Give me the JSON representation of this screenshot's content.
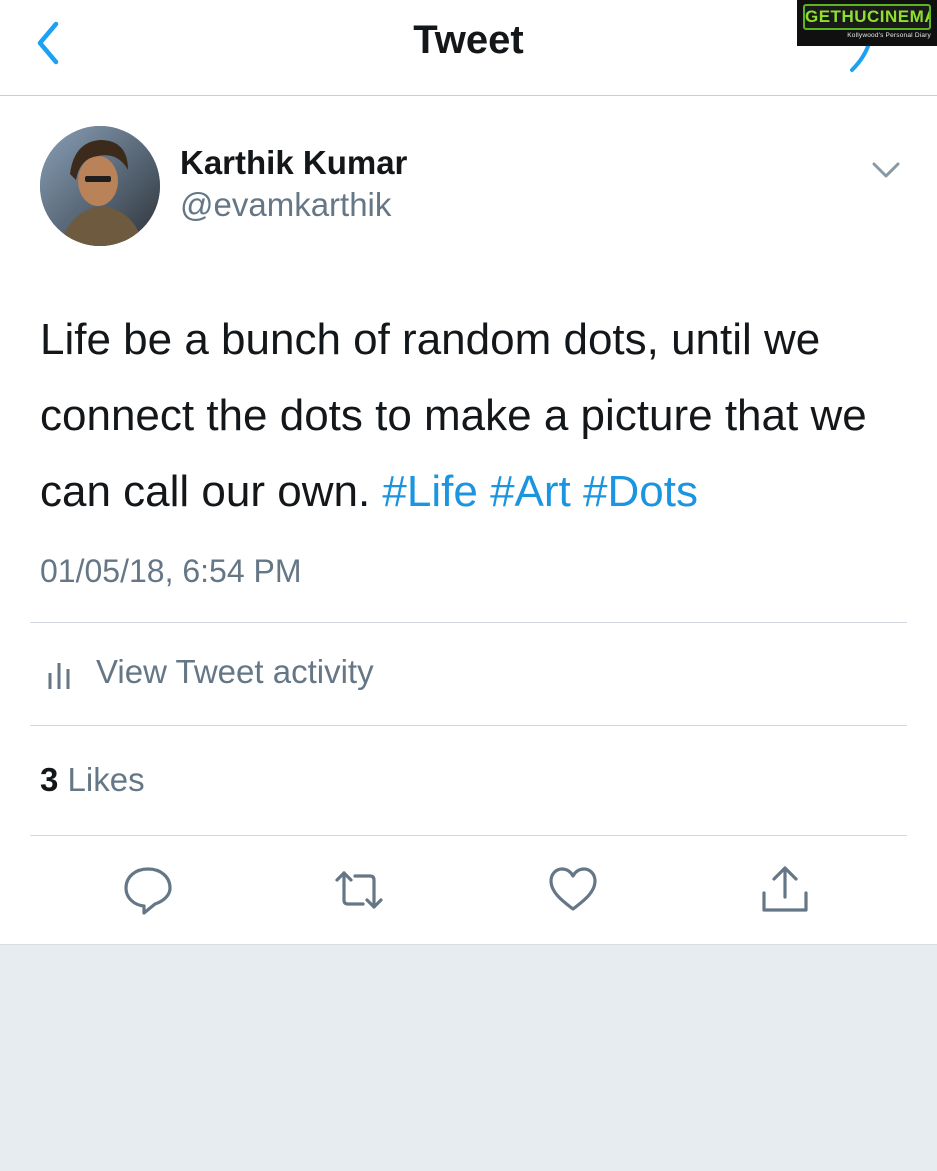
{
  "header": {
    "title": "Tweet",
    "back_icon": "chevron-left-icon",
    "compose_icon": "compose-icon"
  },
  "watermark": {
    "brand": "GETHUCINEMA",
    "tagline": "Kollywood's Personal Diary"
  },
  "tweet": {
    "author": {
      "name": "Karthik Kumar",
      "handle": "@evamkarthik"
    },
    "text": "Life be a bunch of random dots, until we connect the dots to make a picture that we can call our own.",
    "hashtags": [
      "#Life",
      "#Art",
      "#Dots"
    ],
    "timestamp": "01/05/18, 6:54 PM",
    "activity_label": "View Tweet activity",
    "likes": {
      "count": "3",
      "label": "Likes"
    },
    "actions": [
      "reply-icon",
      "retweet-icon",
      "like-icon",
      "share-icon"
    ]
  },
  "colors": {
    "accent": "#1b95e0",
    "secondary_text": "#657786",
    "primary_text": "#14171a",
    "icon": "#657786",
    "page_background": "#e6ecf0",
    "watermark_green": "#8ee02f"
  }
}
